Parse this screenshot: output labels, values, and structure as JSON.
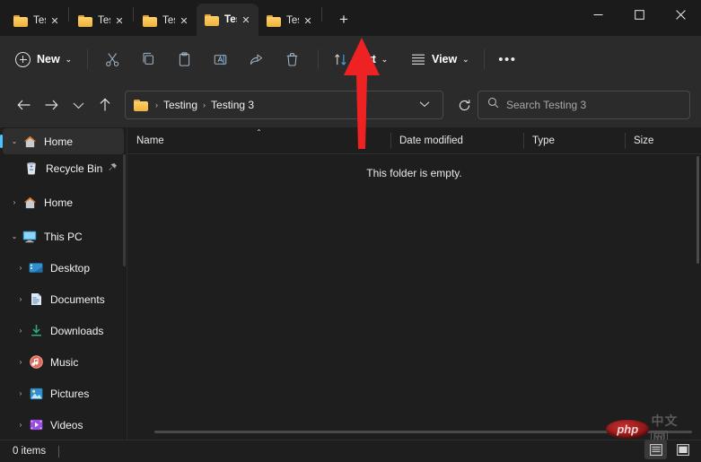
{
  "window": {
    "controls": {
      "minimize": "minimize-button",
      "maximize": "maximize-button",
      "close": "close-button"
    }
  },
  "tabs": {
    "items": [
      {
        "label": "Testing",
        "active": false
      },
      {
        "label": "Testing",
        "active": false
      },
      {
        "label": "Testing",
        "active": false
      },
      {
        "label": "Testing",
        "active": true
      },
      {
        "label": "Testing",
        "active": false
      }
    ],
    "new_tab_label": "+",
    "close_label": "✕"
  },
  "toolbar": {
    "new_label": "New",
    "cut_label": "Cut",
    "copy_label": "Copy",
    "paste_label": "Paste",
    "rename_label": "Rename",
    "share_label": "Share",
    "delete_label": "Delete",
    "sort_label": "Sort",
    "view_label": "View",
    "more_label": "•••",
    "chevron": "⌄"
  },
  "address": {
    "back_label": "←",
    "forward_label": "→",
    "recent_label": "⌄",
    "up_label": "↑",
    "crumbs": [
      "Testing",
      "Testing 3"
    ],
    "separator": "›",
    "dropdown_chevron": "⌄",
    "refresh_label": "↻"
  },
  "search": {
    "placeholder": "Search Testing 3"
  },
  "sidebar": {
    "items": [
      {
        "label": "Home",
        "icon": "home-icon",
        "expander": "⌄",
        "level": 0,
        "selected": true,
        "pinned": false
      },
      {
        "label": "Recycle Bin",
        "icon": "recycle-bin-icon",
        "expander": "",
        "level": 1,
        "selected": false,
        "pinned": true
      },
      {
        "label": "Home",
        "icon": "home-icon",
        "expander": "›",
        "level": 0,
        "selected": false,
        "pinned": false
      },
      {
        "label": "This PC",
        "icon": "this-pc-icon",
        "expander": "⌄",
        "level": 0,
        "selected": false,
        "pinned": false
      },
      {
        "label": "Desktop",
        "icon": "desktop-icon",
        "expander": "›",
        "level": 1,
        "selected": false,
        "pinned": false
      },
      {
        "label": "Documents",
        "icon": "documents-icon",
        "expander": "›",
        "level": 1,
        "selected": false,
        "pinned": false
      },
      {
        "label": "Downloads",
        "icon": "downloads-icon",
        "expander": "›",
        "level": 1,
        "selected": false,
        "pinned": false
      },
      {
        "label": "Music",
        "icon": "music-icon",
        "expander": "›",
        "level": 1,
        "selected": false,
        "pinned": false
      },
      {
        "label": "Pictures",
        "icon": "pictures-icon",
        "expander": "›",
        "level": 1,
        "selected": false,
        "pinned": false
      },
      {
        "label": "Videos",
        "icon": "videos-icon",
        "expander": "›",
        "level": 1,
        "selected": false,
        "pinned": false
      }
    ],
    "pin_glyph": "📌"
  },
  "columns": {
    "name": "Name",
    "date_modified": "Date modified",
    "type": "Type",
    "size": "Size",
    "sort_indicator": "⌃"
  },
  "content": {
    "empty_message": "This folder is empty."
  },
  "status": {
    "item_count": "0 items"
  },
  "annotation": {
    "arrow_color": "#ee2222",
    "points_to": "active-tab"
  },
  "watermark": {
    "logo_text": "php",
    "site_text_1": "中文",
    "site_text_2": "网"
  }
}
